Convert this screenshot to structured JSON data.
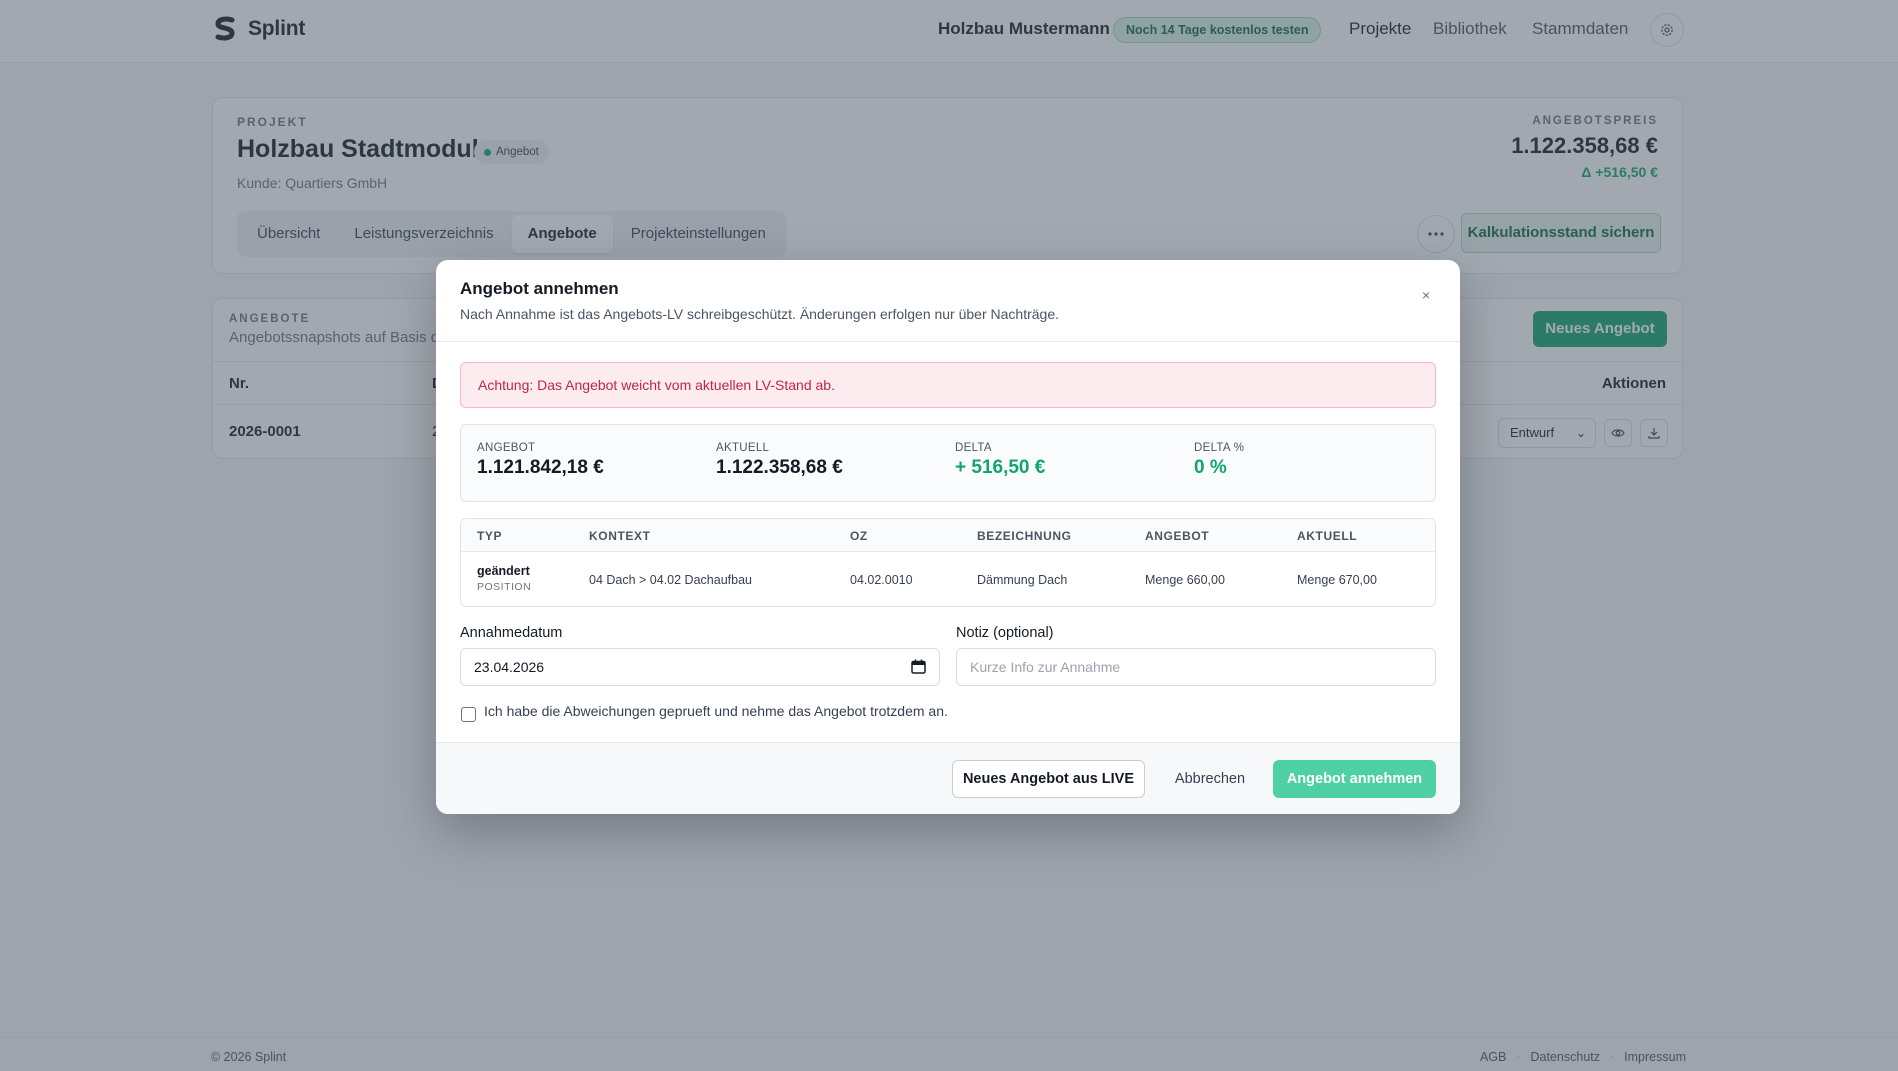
{
  "header": {
    "logo_text": "Splint",
    "company": "Holzbau Mustermann",
    "trial_badge": "Noch 14 Tage kostenlos testen",
    "nav": [
      {
        "label": "Projekte"
      },
      {
        "label": "Bibliothek"
      },
      {
        "label": "Stammdaten"
      }
    ]
  },
  "project": {
    "eyebrow": "PROJEKT",
    "title": "Holzbau Stadtmodul",
    "status": "Angebot",
    "client": "Kunde: Quartiers GmbH",
    "tabs": [
      {
        "label": "Übersicht"
      },
      {
        "label": "Leistungsverzeichnis"
      },
      {
        "label": "Angebote"
      },
      {
        "label": "Projekteinstellungen"
      }
    ],
    "price_label": "ANGEBOTSPREIS",
    "price_value": "1.122.358,68 €",
    "price_delta": "Δ +516,50 €",
    "save_button": "Kalkulationsstand sichern"
  },
  "offers": {
    "eyebrow": "ANGEBOTE",
    "subtitle": "Angebotssnapshots auf Basis de",
    "new_button": "Neues Angebot",
    "columns": {
      "nr": "Nr.",
      "col2": "D",
      "actions": "Aktionen"
    },
    "rows": [
      {
        "nr": "2026-0001",
        "col2": "2",
        "status": "Entwurf"
      }
    ]
  },
  "modal": {
    "title": "Angebot annehmen",
    "subtitle": "Nach Annahme ist das Angebots-LV schreibgeschützt. Änderungen erfolgen nur über Nachträge.",
    "close": "×",
    "alert": "Achtung: Das Angebot weicht vom aktuellen LV-Stand ab.",
    "stats": [
      {
        "label": "ANGEBOT",
        "value": "1.121.842,18 €"
      },
      {
        "label": "AKTUELL",
        "value": "1.122.358,68 €"
      },
      {
        "label": "DELTA",
        "value": "+ 516,50 €"
      },
      {
        "label": "DELTA %",
        "value": "0 %"
      }
    ],
    "diff_table": {
      "columns": [
        "TYP",
        "KONTEXT",
        "OZ",
        "BEZEICHNUNG",
        "ANGEBOT",
        "AKTUELL"
      ],
      "rows": [
        {
          "typ": "geändert",
          "typ_sub": "POSITION",
          "kontext": "04 Dach > 04.02 Dachaufbau",
          "oz": "04.02.0010",
          "bezeichnung": "Dämmung Dach",
          "angebot": "Menge 660,00",
          "aktuell": "Menge 670,00"
        }
      ]
    },
    "date_label": "Annahmedatum",
    "date_value": "23.04.2026",
    "note_label": "Notiz (optional)",
    "note_placeholder": "Kurze Info zur Annahme",
    "checkbox_label": "Ich habe die Abweichungen geprueft und nehme das Angebot trotzdem an.",
    "checkbox_checked": false,
    "buttons": {
      "new_from_live": "Neues Angebot aus LIVE",
      "cancel": "Abbrechen",
      "accept": "Angebot annehmen"
    }
  },
  "footer": {
    "copyright": "© 2026 Splint",
    "links": [
      "AGB",
      "Datenschutz",
      "Impressum"
    ]
  },
  "colors": {
    "accent": "#10a56b",
    "alert_text": "#c0264a",
    "overlay": "#465261"
  }
}
